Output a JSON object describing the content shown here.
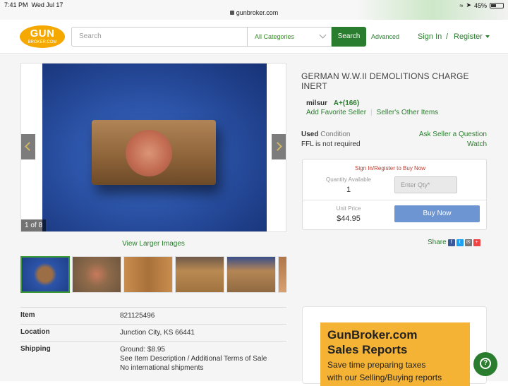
{
  "status_bar": {
    "time": "7:41 PM",
    "date": "Wed Jul 17",
    "battery": "45%",
    "url": "gunbroker.com"
  },
  "header": {
    "logo_top": "GUN",
    "logo_bottom": "BROKER.COM",
    "search_placeholder": "Search",
    "category_selected": "All Categories",
    "search_button": "Search",
    "advanced": "Advanced",
    "sign_in": "Sign In",
    "separator": "/",
    "register": "Register"
  },
  "gallery": {
    "counter": "1 of 8",
    "view_larger": "View Larger Images"
  },
  "details": {
    "rows": [
      {
        "key": "Item",
        "lines": [
          "821125496"
        ]
      },
      {
        "key": "Location",
        "lines": [
          "Junction City, KS 66441"
        ]
      },
      {
        "key": "Shipping",
        "lines": [
          "Ground: $8.95",
          "See Item Description / Additional Terms of Sale",
          "No international shipments"
        ]
      }
    ]
  },
  "listing": {
    "title": "GERMAN W.W.II DEMOLITIONS CHARGE INERT",
    "seller_name": "milsur",
    "seller_rating": "A+(166)",
    "add_favorite": "Add Favorite Seller",
    "other_items": "Seller's Other Items",
    "condition_label": "Used",
    "condition_suffix": "Condition",
    "ffl": "FFL is not required",
    "ask_seller": "Ask Seller a Question",
    "watch": "Watch"
  },
  "buybox": {
    "sign_in_notice": "Sign In/Register to Buy Now",
    "quantity_label": "Quantity Available",
    "quantity_value": "1",
    "qty_placeholder": "Enter Qty*",
    "unit_price_label": "Unit Price",
    "unit_price_value": "$44.95",
    "buy_now": "Buy Now"
  },
  "share": {
    "label": "Share"
  },
  "ad": {
    "headline_1": "GunBroker.com",
    "headline_2": "Sales Reports",
    "sub_1": "Save time preparing taxes",
    "sub_2": "with our Selling/Buying reports"
  },
  "help": {
    "icon": "?"
  }
}
